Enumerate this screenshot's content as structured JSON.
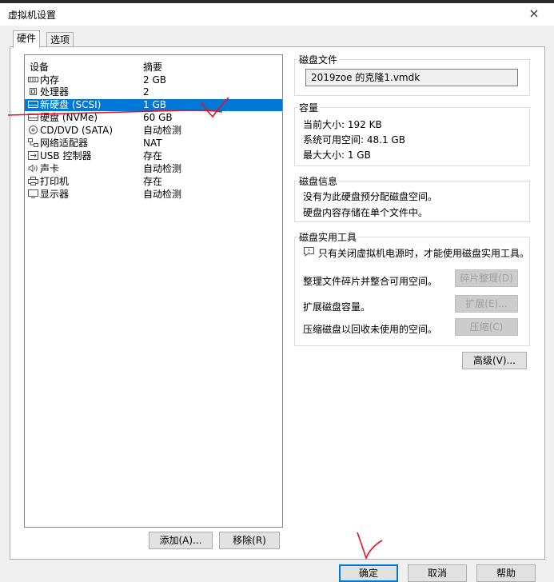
{
  "window": {
    "title": "虚拟机设置",
    "close": "×"
  },
  "tabs": [
    {
      "label": "硬件"
    },
    {
      "label": "选项"
    }
  ],
  "device_list": {
    "headers": {
      "device": "设备",
      "summary": "摘要"
    },
    "rows": [
      {
        "name": "内存",
        "summary": "2 GB",
        "icon": "memory-icon"
      },
      {
        "name": "处理器",
        "summary": "2",
        "icon": "cpu-icon"
      },
      {
        "name": "新硬盘 (SCSI)",
        "summary": "1 GB",
        "icon": "disk-icon",
        "selected": true
      },
      {
        "name": "硬盘 (NVMe)",
        "summary": "60 GB",
        "icon": "disk-icon"
      },
      {
        "name": "CD/DVD (SATA)",
        "summary": "自动检测",
        "icon": "cd-icon"
      },
      {
        "name": "网络适配器",
        "summary": "NAT",
        "icon": "network-icon"
      },
      {
        "name": "USB 控制器",
        "summary": "存在",
        "icon": "usb-icon"
      },
      {
        "name": "声卡",
        "summary": "自动检测",
        "icon": "sound-icon"
      },
      {
        "name": "打印机",
        "summary": "存在",
        "icon": "printer-icon"
      },
      {
        "name": "显示器",
        "summary": "自动检测",
        "icon": "monitor-icon"
      }
    ]
  },
  "list_buttons": {
    "add": "添加(A)...",
    "remove": "移除(R)"
  },
  "disk_file": {
    "title": "磁盘文件",
    "value": "2019zoe 的克隆1.vmdk"
  },
  "capacity": {
    "title": "容量",
    "current": "当前大小: 192 KB",
    "available": "系统可用空间: 48.1 GB",
    "max": "最大大小: 1 GB"
  },
  "disk_info": {
    "title": "磁盘信息",
    "line1": "没有为此硬盘预分配磁盘空间。",
    "line2": "硬盘内容存储在单个文件中。"
  },
  "disk_tools": {
    "title": "磁盘实用工具",
    "notice": "只有关闭虚拟机电源时，才能使用磁盘实用工具。",
    "defrag_label": "整理文件碎片并整合可用空间。",
    "defrag_btn": "碎片整理(D)",
    "expand_label": "扩展磁盘容量。",
    "expand_btn": "扩展(E)...",
    "compact_label": "压缩磁盘以回收未使用的空间。",
    "compact_btn": "压缩(C)"
  },
  "advanced_btn": "高级(V)...",
  "footer": {
    "ok": "确定",
    "cancel": "取消",
    "help": "帮助"
  },
  "colors": {
    "selection": "#0078d7",
    "annotation": "#e81123"
  }
}
